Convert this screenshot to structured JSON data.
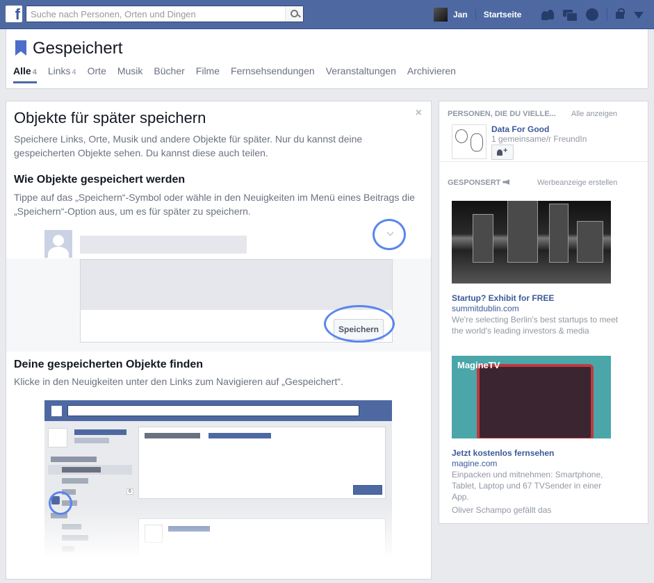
{
  "topbar": {
    "logo": "f",
    "search_placeholder": "Suche nach Personen, Orten und Dingen",
    "user_name": "Jan",
    "home": "Startseite"
  },
  "header": {
    "title": "Gespeichert",
    "tabs": [
      {
        "label": "Alle",
        "count": "4"
      },
      {
        "label": "Links",
        "count": "4"
      },
      {
        "label": "Orte",
        "count": ""
      },
      {
        "label": "Musik",
        "count": ""
      },
      {
        "label": "Bücher",
        "count": ""
      },
      {
        "label": "Filme",
        "count": ""
      },
      {
        "label": "Fernsehsendungen",
        "count": ""
      },
      {
        "label": "Veranstaltungen",
        "count": ""
      },
      {
        "label": "Archivieren",
        "count": ""
      }
    ]
  },
  "intro": {
    "close": "×",
    "title": "Objekte für später speichern",
    "desc": "Speichere Links, Orte, Musik und andere Objekte für später. Nur du kannst deine gespeicherten Objekte sehen. Du kannst diese auch teilen.",
    "how_title": "Wie Objekte gespeichert werden",
    "how_desc": "Tippe auf das „Speichern“-Symbol oder wähle in den Neuigkeiten im Menü eines Beitrags die „Speichern“-Option aus, um es für später zu speichern.",
    "save_button": "Speichern",
    "find_title": "Deine gespeicherten Objekte finden",
    "find_desc": "Klicke in den Neuigkeiten unter den Links zum Navigieren auf „Gespeichert“.",
    "mini_badge": "6"
  },
  "right": {
    "pymk": {
      "header": "PERSONEN, DIE DU VIELLE...",
      "see_all": "Alle anzeigen",
      "name": "Data For Good",
      "mutual": "1 gemeinsame/r FreundIn"
    },
    "sponsored": {
      "header": "GESPONSERT",
      "create_ad": "Werbeanzeige erstellen",
      "ads": [
        {
          "title": "Startup? Exhibit for FREE",
          "url": "summitdublin.com",
          "desc": "We're selecting Berlin's best startups to meet the world's leading investors & media"
        },
        {
          "logo": "MagineTV",
          "title": "Jetzt kostenlos fernsehen",
          "url": "magine.com",
          "desc": "Einpacken und mitnehmen: Smartphone, Tablet, Laptop und 67 TVSender in einer App.",
          "social": "Oliver Schampo gefällt das"
        }
      ]
    }
  }
}
